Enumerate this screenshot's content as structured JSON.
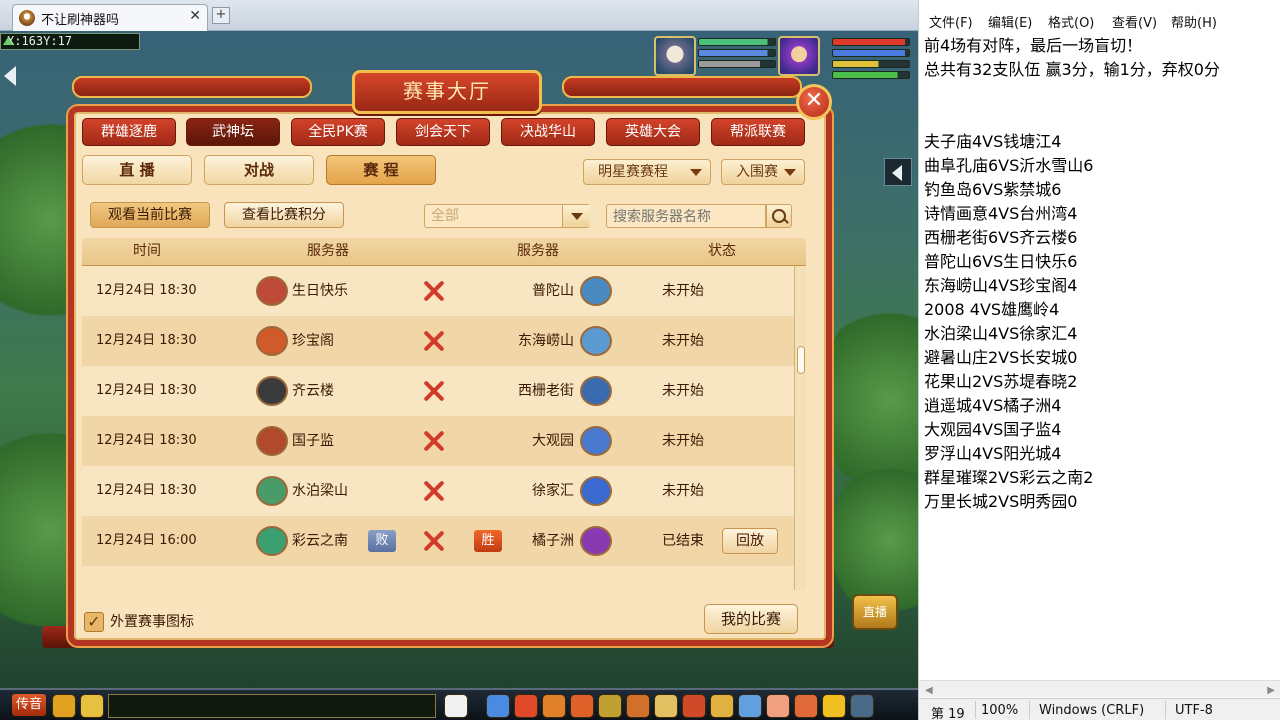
{
  "browser": {
    "tab_title": "不让刷神器吗",
    "tab_close": "✕",
    "new_tab": "+"
  },
  "game": {
    "coordinates": "X:163Y:17",
    "dialog": {
      "title": "赛事大厅",
      "close": "✕",
      "categories": [
        {
          "label": "群雄逐鹿",
          "active": false
        },
        {
          "label": "武神坛",
          "active": true
        },
        {
          "label": "全民PK赛",
          "active": false
        },
        {
          "label": "剑会天下",
          "active": false
        },
        {
          "label": "决战华山",
          "active": false
        },
        {
          "label": "英雄大会",
          "active": false
        },
        {
          "label": "帮派联赛",
          "active": false
        }
      ],
      "sub_tabs": [
        {
          "label": "直 播",
          "active": false
        },
        {
          "label": "对战",
          "active": false
        },
        {
          "label": "赛 程",
          "active": true
        }
      ],
      "dropdowns": [
        "明星赛赛程",
        "入围赛"
      ],
      "toolbar": {
        "current_match": "观看当前比赛",
        "check_points": "查看比赛积分",
        "filter_value": "全部",
        "search_placeholder": "搜索服务器名称"
      },
      "columns": [
        "时间",
        "服务器",
        "服务器",
        "状态"
      ],
      "rows": [
        {
          "time": "12月24日 18:30",
          "server_a": "生日快乐",
          "server_b": "普陀山",
          "status": "未开始",
          "icon_a": "#c04a3a",
          "icon_b": "#4a8ac0"
        },
        {
          "time": "12月24日 18:30",
          "server_a": "珍宝阁",
          "server_b": "东海崂山",
          "status": "未开始",
          "icon_a": "#d05a2a",
          "icon_b": "#5a9ad0"
        },
        {
          "time": "12月24日 18:30",
          "server_a": "齐云楼",
          "server_b": "西栅老街",
          "status": "未开始",
          "icon_a": "#3a3a3a",
          "icon_b": "#3a6ab0"
        },
        {
          "time": "12月24日 18:30",
          "server_a": "国子监",
          "server_b": "大观园",
          "status": "未开始",
          "icon_a": "#b04a2a",
          "icon_b": "#4a7ad0"
        },
        {
          "time": "12月24日 18:30",
          "server_a": "水泊梁山",
          "server_b": "徐家汇",
          "status": "未开始",
          "icon_a": "#4a9a6a",
          "icon_b": "#3a6ad0"
        },
        {
          "time": "12月24日 16:00",
          "server_a": "彩云之南",
          "server_b": "橘子洲",
          "status": "已结束",
          "icon_a": "#3aa070",
          "icon_b": "#8a3ab0",
          "result_a": "败",
          "result_b": "胜",
          "replay": "回放"
        }
      ],
      "checkbox_label": "外置赛事图标",
      "checkbox_mark": "✓",
      "my_matches": "我的比赛"
    },
    "bottom": {
      "chat_label": "传音"
    },
    "live_label": "直播"
  },
  "notepad": {
    "menu": [
      "文件(F)",
      "编辑(E)",
      "格式(O)",
      "查看(V)",
      "帮助(H)"
    ],
    "lines": [
      "前4场有对阵，最后一场盲切！",
      "总共有32支队伍 赢3分，输1分，弃权0分",
      "",
      "",
      "夫子庙4VS钱塘江4",
      "曲阜孔庙6VS沂水雪山6",
      "钓鱼岛6VS紫禁城6",
      "诗情画意4VS台州湾4",
      "西栅老街6VS齐云楼6",
      "普陀山6VS生日快乐6",
      "东海崂山4VS珍宝阁4",
      "2008 4VS雄鹰岭4",
      "水泊梁山4VS徐家汇4",
      "避暑山庄2VS长安城0",
      "花果山2VS苏堤春晓2",
      "逍遥城4VS橘子洲4",
      "大观园4VS国子监4",
      "罗浮山4VS阳光城4",
      "群星璀璨2VS彩云之南2",
      "万里长城2VS明秀园0"
    ],
    "status": {
      "position": "第 19",
      "zoom": "100%",
      "line_ending": "Windows (CRLF)",
      "encoding": "UTF-8"
    }
  }
}
